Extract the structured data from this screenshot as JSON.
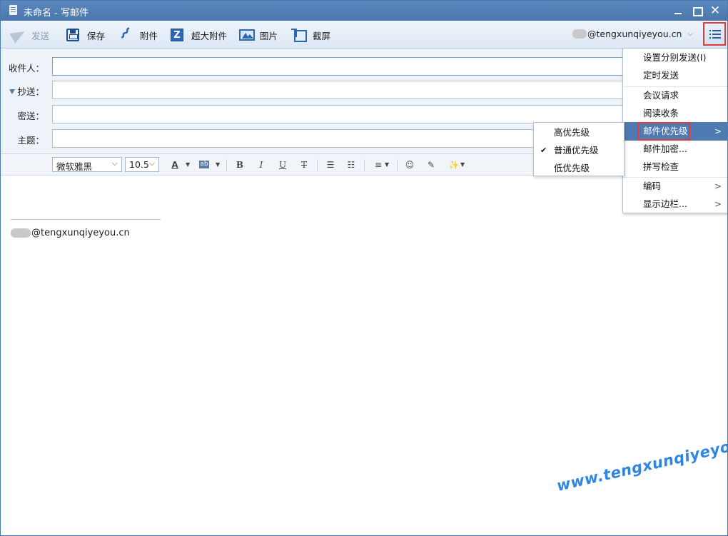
{
  "window": {
    "title": "未命名 - 写邮件"
  },
  "toolbar": {
    "send": "发送",
    "save": "保存",
    "attach": "附件",
    "large_attach": "超大附件",
    "image": "图片",
    "screenshot": "截屏",
    "account": "@tengxunqiyeyou.cn"
  },
  "fields": {
    "to_label": "收件人：",
    "cc_label": "抄送：",
    "bcc_label": "密送：",
    "subject_label": "主题：",
    "to_value": "",
    "cc_value": "",
    "bcc_value": "",
    "subject_value": ""
  },
  "format": {
    "font": "微软雅黑",
    "size": "10.5",
    "bold": "B",
    "italic": "I",
    "underline": "U",
    "strike": "T"
  },
  "body": {
    "signature": "@tengxunqiyeyou.cn"
  },
  "menu": {
    "items": [
      {
        "label": "设置分别发送(I)"
      },
      {
        "label": "定时发送"
      },
      {
        "label": "会议请求"
      },
      {
        "label": "阅读收条"
      },
      {
        "label": "邮件优先级",
        "highlighted": true,
        "submenu": true
      },
      {
        "label": "邮件加密..."
      },
      {
        "label": "拼写检查"
      },
      {
        "label": "编码",
        "submenu": true
      },
      {
        "label": "显示边栏...",
        "submenu": true
      }
    ]
  },
  "priority_menu": {
    "items": [
      {
        "label": "高优先级",
        "checked": false
      },
      {
        "label": "普通优先级",
        "checked": true
      },
      {
        "label": "低优先级",
        "checked": false
      }
    ]
  },
  "watermark": "www.tengxunqiyeyou.com",
  "colors": {
    "titlebar": "#5b89bf",
    "highlight": "#4f7ab2",
    "annotation_red": "#e23b3b",
    "watermark_blue": "#2f86e0"
  }
}
